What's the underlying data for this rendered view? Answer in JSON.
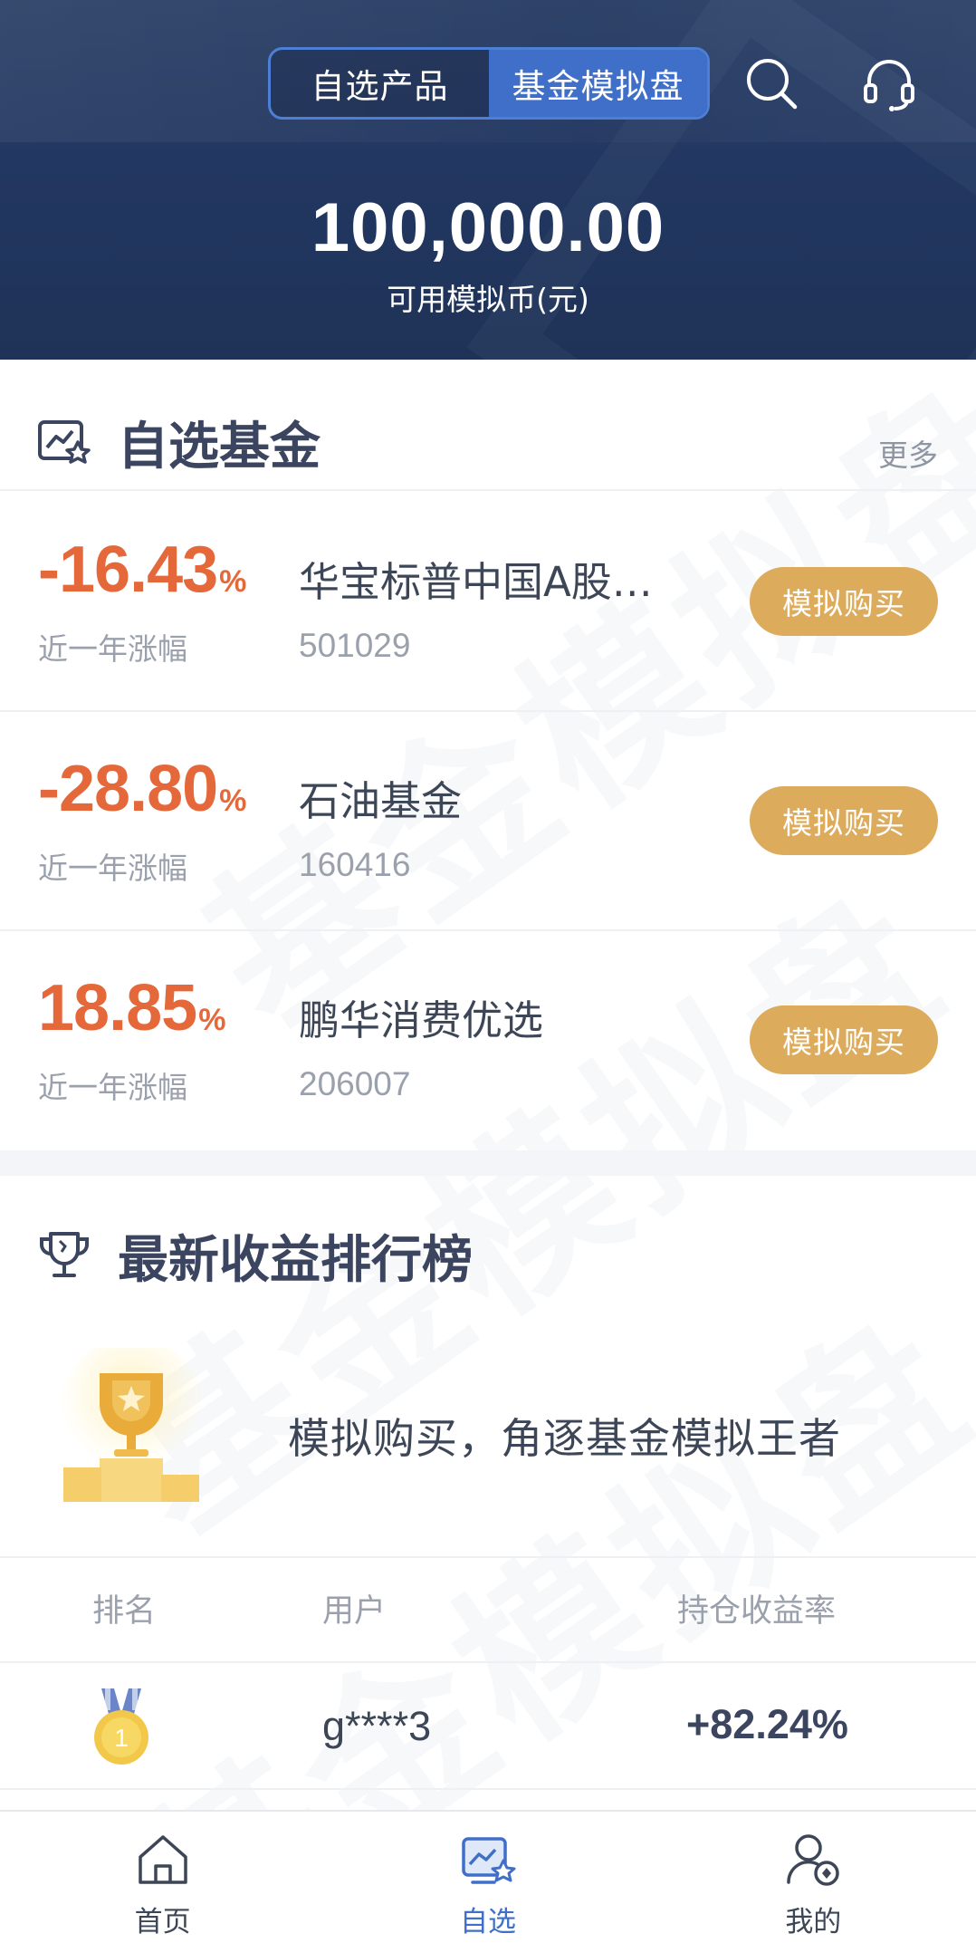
{
  "header": {
    "tabs": [
      {
        "label": "自选产品",
        "active": false
      },
      {
        "label": "基金模拟盘",
        "active": true
      }
    ],
    "search_icon": "search-icon",
    "service_icon": "headset-icon",
    "balance": "100,000.00",
    "balance_label": "可用模拟币(元)"
  },
  "watchlist": {
    "title": "自选基金",
    "more": "更多",
    "funds": [
      {
        "rate": "-16.43",
        "pct": "%",
        "rate_label": "近一年涨幅",
        "name": "华宝标普中国A股…",
        "code": "501029",
        "button": "模拟购买"
      },
      {
        "rate": "-28.80",
        "pct": "%",
        "rate_label": "近一年涨幅",
        "name": "石油基金",
        "code": "160416",
        "button": "模拟购买"
      },
      {
        "rate": "18.85",
        "pct": "%",
        "rate_label": "近一年涨幅",
        "name": "鹏华消费优选",
        "code": "206007",
        "button": "模拟购买"
      }
    ]
  },
  "ranking": {
    "title": "最新收益排行榜",
    "slogan": "模拟购买，角逐基金模拟王者",
    "columns": [
      "排名",
      "用户",
      "持仓收益率"
    ],
    "rows": [
      {
        "rank": "1",
        "user": "g****3",
        "rate": "+82.24%"
      }
    ]
  },
  "watermark": "基金模拟盘",
  "nav": [
    {
      "label": "首页",
      "icon": "home-icon",
      "active": false
    },
    {
      "label": "自选",
      "icon": "watchlist-icon",
      "active": true
    },
    {
      "label": "我的",
      "icon": "profile-icon",
      "active": false
    }
  ],
  "colors": {
    "header_bg": "#223761",
    "accent_blue": "#3f6fc8",
    "negative_orange": "#e5683b",
    "buy_button": "#dcab5c"
  }
}
